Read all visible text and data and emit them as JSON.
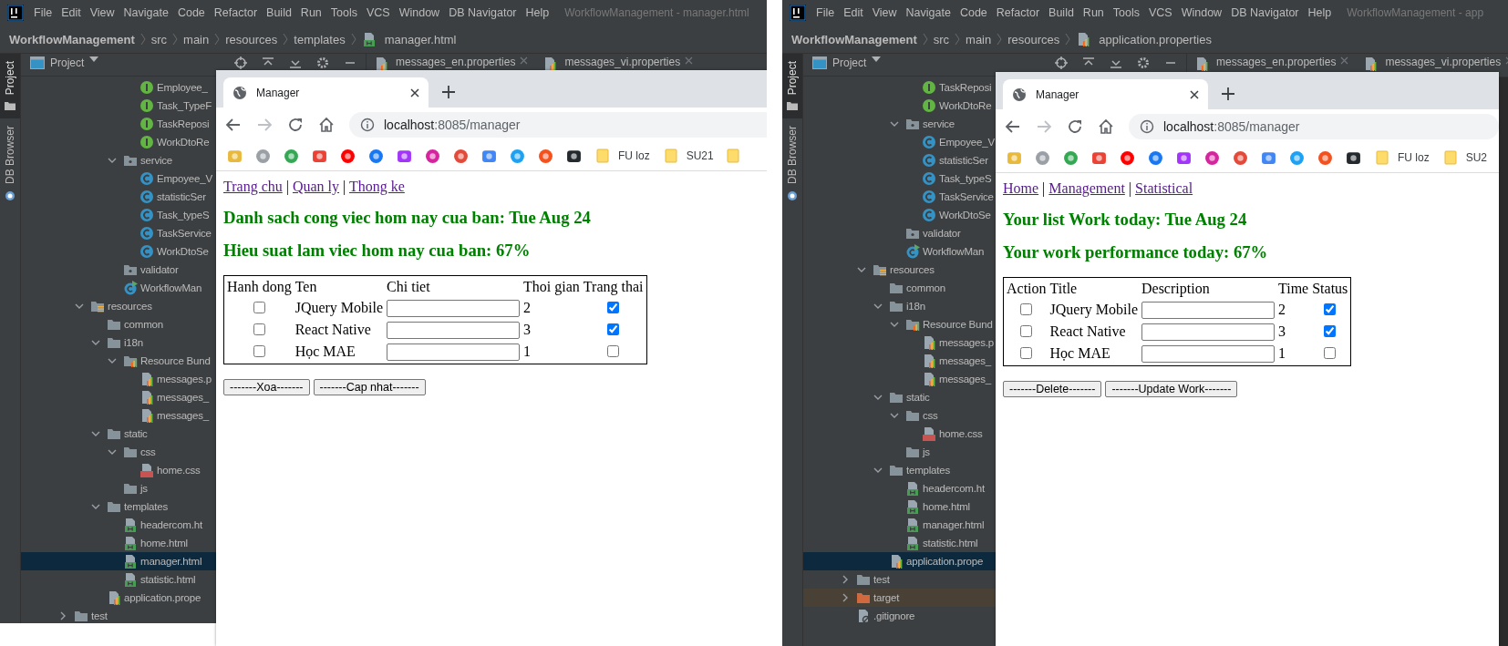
{
  "panels": [
    {
      "ide": {
        "menu": [
          "File",
          "Edit",
          "View",
          "Navigate",
          "Code",
          "Refactor",
          "Build",
          "Run",
          "Tools",
          "VCS",
          "Window",
          "DB Navigator",
          "Help"
        ],
        "title_text": "WorkflowManagement - manager.html",
        "breadcrumb": [
          {
            "label": "WorkflowManagement",
            "kind": "project"
          },
          {
            "label": "src",
            "kind": "dir"
          },
          {
            "label": "main",
            "kind": "dir"
          },
          {
            "label": "resources",
            "kind": "dir"
          },
          {
            "label": "templates",
            "kind": "dir"
          },
          {
            "label": "manager.html",
            "kind": "html"
          }
        ],
        "tool_windows": [
          {
            "label": "Project",
            "selected": true
          },
          {
            "label": "DB Browser",
            "selected": false
          }
        ],
        "project_header": "Project",
        "editor_tabs": [
          "messages_en.properties",
          "messages_vi.properties"
        ],
        "tree": [
          {
            "children": [
              {
                "children": [
                  {
                    "children": [
                      {
                        "children": [
                          {
                            "label": "Employee_",
                            "kind": "interface",
                            "selected": false
                          },
                          {
                            "label": "Task_TypeF",
                            "kind": "interface",
                            "selected": false
                          },
                          {
                            "label": "TaskReposi",
                            "kind": "interface",
                            "selected": false
                          },
                          {
                            "label": "WorkDtoRe",
                            "kind": "interface",
                            "selected": false
                          }
                        ]
                      },
                      {
                        "label": "service",
                        "kind": "package",
                        "expanded": true,
                        "selected": false,
                        "children": [
                          {
                            "label": "Empoyee_V",
                            "kind": "class",
                            "selected": false
                          },
                          {
                            "label": "statisticSer",
                            "kind": "class",
                            "selected": false
                          },
                          {
                            "label": "Task_typeS",
                            "kind": "class",
                            "selected": false
                          },
                          {
                            "label": "TaskService",
                            "kind": "class",
                            "selected": false
                          },
                          {
                            "label": "WorkDtoSe",
                            "kind": "class",
                            "selected": false
                          }
                        ]
                      },
                      {
                        "label": "validator",
                        "kind": "package",
                        "selected": false
                      },
                      {
                        "label": "WorkflowMan",
                        "kind": "main_class",
                        "selected": false
                      }
                    ]
                  }
                ]
              },
              {
                "label": "resources",
                "kind": "resources_folder",
                "expanded": true,
                "selected": false,
                "children": [
                  {
                    "label": "common",
                    "kind": "folder",
                    "selected": false
                  },
                  {
                    "label": "i18n",
                    "kind": "folder",
                    "expanded": true,
                    "selected": false,
                    "children": [
                      {
                        "label": "Resource Bund",
                        "kind": "bundle",
                        "expanded": true,
                        "selected": false,
                        "children": [
                          {
                            "label": "messages.p",
                            "kind": "properties",
                            "selected": false
                          },
                          {
                            "label": "messages_",
                            "kind": "properties",
                            "selected": false
                          },
                          {
                            "label": "messages_",
                            "kind": "properties",
                            "selected": false
                          }
                        ]
                      }
                    ]
                  },
                  {
                    "label": "static",
                    "kind": "folder",
                    "expanded": true,
                    "selected": false,
                    "children": [
                      {
                        "label": "css",
                        "kind": "folder",
                        "expanded": true,
                        "selected": false,
                        "children": [
                          {
                            "label": "home.css",
                            "kind": "css",
                            "selected": false
                          }
                        ]
                      },
                      {
                        "label": "js",
                        "kind": "folder",
                        "selected": false
                      }
                    ]
                  },
                  {
                    "label": "templates",
                    "kind": "folder",
                    "expanded": true,
                    "selected": false,
                    "children": [
                      {
                        "label": "headercom.ht",
                        "kind": "html",
                        "selected": false
                      },
                      {
                        "label": "home.html",
                        "kind": "html",
                        "selected": false
                      },
                      {
                        "label": "manager.html",
                        "kind": "html",
                        "selected": true
                      },
                      {
                        "label": "statistic.html",
                        "kind": "html",
                        "selected": false
                      }
                    ]
                  },
                  {
                    "label": "application.prope",
                    "kind": "properties",
                    "selected": false
                  }
                ]
              }
            ]
          },
          {
            "label": "test",
            "kind": "folder",
            "expanded": false,
            "selected": false
          }
        ]
      },
      "browser": {
        "tab_title": "Manager",
        "url_host": "localhost",
        "url_rest": ":8085/manager",
        "folders": [
          "FU loz",
          "SU21"
        ],
        "page": {
          "nav": [
            {
              "kind": "link",
              "text": "Trang chu"
            },
            {
              "kind": "separator",
              "text": "|"
            },
            {
              "kind": "link",
              "text": "Quan ly"
            },
            {
              "kind": "separator",
              "text": "|"
            },
            {
              "kind": "link",
              "text": "Thong ke"
            }
          ],
          "headings": [
            "Danh sach cong viec hom nay cua ban: Tue Aug 24",
            "Hieu suat lam viec hom nay cua ban: 67%"
          ],
          "table": {
            "columns": [
              "Hanh dong",
              "Ten",
              "Chi tiet",
              "Thoi gian",
              "Trang thai"
            ],
            "rows": [
              {
                "action_checked": false,
                "title": "JQuery Mobile",
                "time": "2",
                "status_checked": true
              },
              {
                "action_checked": false,
                "title": "React Native",
                "time": "3",
                "status_checked": true
              },
              {
                "action_checked": false,
                "title": "Học MAE",
                "time": "1",
                "status_checked": false
              }
            ]
          },
          "buttons": [
            "-------Xoa-------",
            "-------Cap nhat-------"
          ]
        }
      }
    },
    {
      "ide": {
        "menu": [
          "File",
          "Edit",
          "View",
          "Navigate",
          "Code",
          "Refactor",
          "Build",
          "Run",
          "Tools",
          "VCS",
          "Window",
          "DB Navigator",
          "Help"
        ],
        "title_text": "WorkflowManagement - app",
        "breadcrumb": [
          {
            "label": "WorkflowManagement",
            "kind": "project"
          },
          {
            "label": "src",
            "kind": "dir"
          },
          {
            "label": "main",
            "kind": "dir"
          },
          {
            "label": "resources",
            "kind": "dir"
          },
          {
            "label": "application.properties",
            "kind": "properties"
          }
        ],
        "tool_windows": [
          {
            "label": "Project",
            "selected": true
          },
          {
            "label": "DB Browser",
            "selected": false
          }
        ],
        "project_header": "Project",
        "editor_tabs": [
          "messages_en.properties",
          "messages_vi.properties"
        ],
        "tree": [
          {
            "children": [
              {
                "children": [
                  {
                    "children": [
                      {
                        "children": [
                          {
                            "label": "TaskReposi",
                            "kind": "interface",
                            "selected": false
                          },
                          {
                            "label": "WorkDtoRe",
                            "kind": "interface",
                            "selected": false
                          }
                        ]
                      },
                      {
                        "label": "service",
                        "kind": "package",
                        "expanded": true,
                        "selected": false,
                        "children": [
                          {
                            "label": "Empoyee_V",
                            "kind": "class",
                            "selected": false
                          },
                          {
                            "label": "statisticSer",
                            "kind": "class",
                            "selected": false
                          },
                          {
                            "label": "Task_typeS",
                            "kind": "class",
                            "selected": false
                          },
                          {
                            "label": "TaskService",
                            "kind": "class",
                            "selected": false
                          },
                          {
                            "label": "WorkDtoSe",
                            "kind": "class",
                            "selected": false
                          }
                        ]
                      },
                      {
                        "label": "validator",
                        "kind": "package",
                        "selected": false
                      },
                      {
                        "label": "WorkflowMan",
                        "kind": "main_class",
                        "selected": false
                      }
                    ]
                  }
                ]
              },
              {
                "label": "resources",
                "kind": "resources_folder",
                "expanded": true,
                "selected": false,
                "children": [
                  {
                    "label": "common",
                    "kind": "folder",
                    "selected": false
                  },
                  {
                    "label": "i18n",
                    "kind": "folder",
                    "expanded": true,
                    "selected": false,
                    "children": [
                      {
                        "label": "Resource Bund",
                        "kind": "bundle",
                        "expanded": true,
                        "selected": false,
                        "children": [
                          {
                            "label": "messages.p",
                            "kind": "properties",
                            "selected": false
                          },
                          {
                            "label": "messages_",
                            "kind": "properties",
                            "selected": false
                          },
                          {
                            "label": "messages_",
                            "kind": "properties",
                            "selected": false
                          }
                        ]
                      }
                    ]
                  },
                  {
                    "label": "static",
                    "kind": "folder",
                    "expanded": true,
                    "selected": false,
                    "children": [
                      {
                        "label": "css",
                        "kind": "folder",
                        "expanded": true,
                        "selected": false,
                        "children": [
                          {
                            "label": "home.css",
                            "kind": "css",
                            "selected": false
                          }
                        ]
                      },
                      {
                        "label": "js",
                        "kind": "folder",
                        "selected": false
                      }
                    ]
                  },
                  {
                    "label": "templates",
                    "kind": "folder",
                    "expanded": true,
                    "selected": false,
                    "children": [
                      {
                        "label": "headercom.ht",
                        "kind": "html",
                        "selected": false
                      },
                      {
                        "label": "home.html",
                        "kind": "html",
                        "selected": false
                      },
                      {
                        "label": "manager.html",
                        "kind": "html",
                        "selected": false
                      },
                      {
                        "label": "statistic.html",
                        "kind": "html",
                        "selected": false
                      }
                    ]
                  },
                  {
                    "label": "application.prope",
                    "kind": "properties",
                    "selected": true
                  }
                ]
              }
            ]
          },
          {
            "label": "test",
            "kind": "folder",
            "expanded": false,
            "selected": false
          },
          {
            "label": "target",
            "kind": "excluded_folder",
            "expanded": false,
            "selected": false
          },
          {
            "label": ".gitignore",
            "kind": "ignore_file",
            "selected": false
          }
        ]
      },
      "browser": {
        "tab_title": "Manager",
        "url_host": "localhost",
        "url_rest": ":8085/manager",
        "folders": [
          "FU loz",
          "SU2"
        ],
        "page": {
          "nav": [
            {
              "kind": "link",
              "text": "Home"
            },
            {
              "kind": "separator",
              "text": "|"
            },
            {
              "kind": "link",
              "text": "Management"
            },
            {
              "kind": "separator",
              "text": "|"
            },
            {
              "kind": "link",
              "text": "Statistical"
            }
          ],
          "headings": [
            "Your list Work today: Tue Aug 24",
            "Your work performance today: 67%"
          ],
          "table": {
            "columns": [
              "Action",
              "Title",
              "Description",
              "Time",
              "Status"
            ],
            "rows": [
              {
                "action_checked": false,
                "title": "JQuery Mobile",
                "time": "2",
                "status_checked": true
              },
              {
                "action_checked": false,
                "title": "React Native",
                "time": "3",
                "status_checked": true
              },
              {
                "action_checked": false,
                "title": "Học MAE",
                "time": "1",
                "status_checked": false
              }
            ]
          },
          "buttons": [
            "-------Delete-------",
            "-------Update Work-------"
          ]
        }
      }
    }
  ]
}
